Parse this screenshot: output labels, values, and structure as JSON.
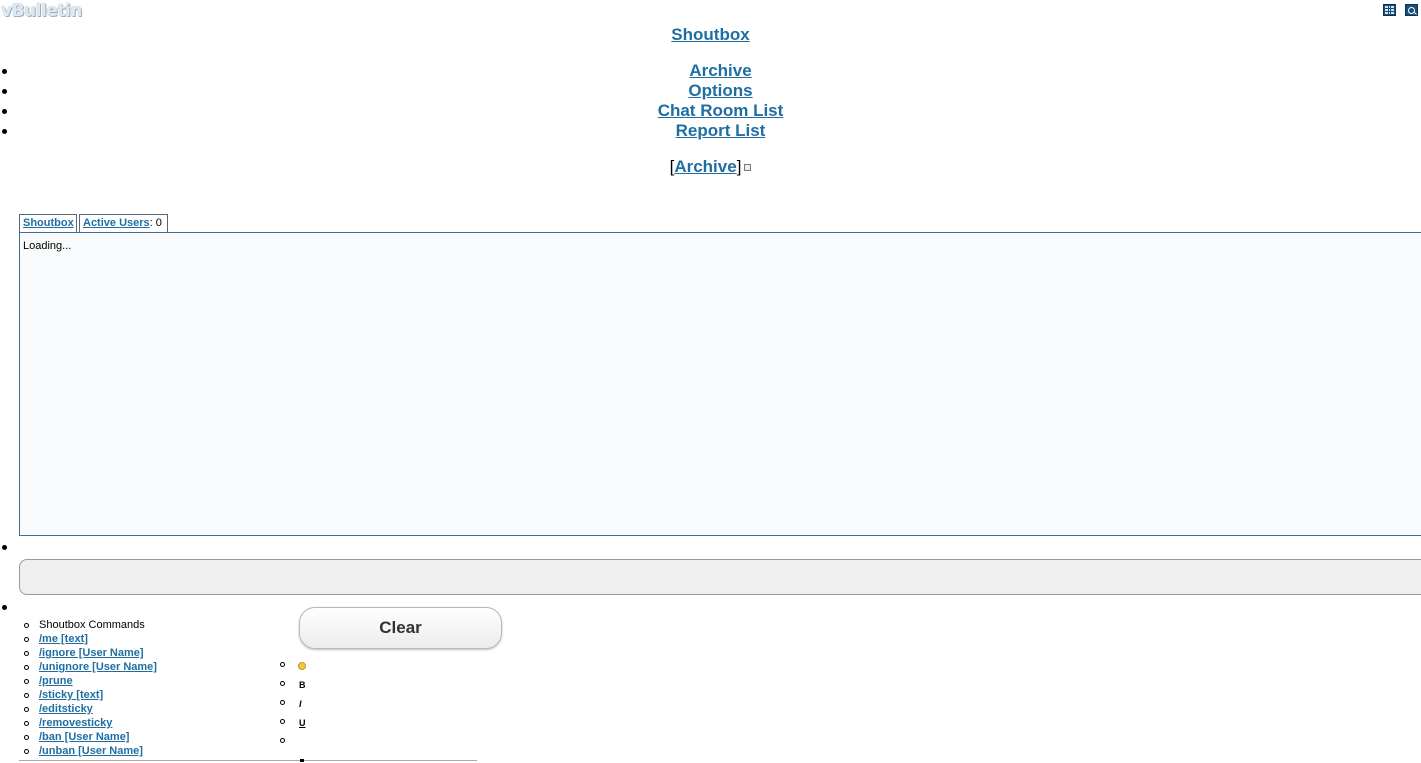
{
  "logo": {
    "text": "vBulletin"
  },
  "header": {
    "title": "Shoutbox"
  },
  "nav": {
    "items": [
      {
        "label": "Archive"
      },
      {
        "label": "Options"
      },
      {
        "label": "Chat Room List"
      },
      {
        "label": "Report List"
      }
    ]
  },
  "archive_link": {
    "open": "[",
    "label": "Archive",
    "close": "]"
  },
  "tabs": {
    "shoutbox": "Shoutbox",
    "active_users_label": "Active Users",
    "active_users_sep": ":",
    "active_users_count": "0"
  },
  "shout_area": {
    "status": "Loading..."
  },
  "buttons": {
    "clear": "Clear"
  },
  "commands": {
    "title": "Shoutbox Commands",
    "items": [
      "/me [text]",
      "/ignore [User Name]",
      "/unignore [User Name]",
      "/prune",
      "/sticky [text]",
      "/editsticky",
      "/removesticky",
      "/ban [User Name]",
      "/unban [User Name]"
    ]
  },
  "format": {
    "bold": "B",
    "italic": "I",
    "underline": "U"
  },
  "icons": {
    "grid": "grid-icon",
    "search": "search-icon",
    "smiley": "smiley-icon",
    "collapse": "collapse-icon"
  },
  "colors": {
    "link": "#1f6ea2",
    "border": "#3b6e96"
  }
}
